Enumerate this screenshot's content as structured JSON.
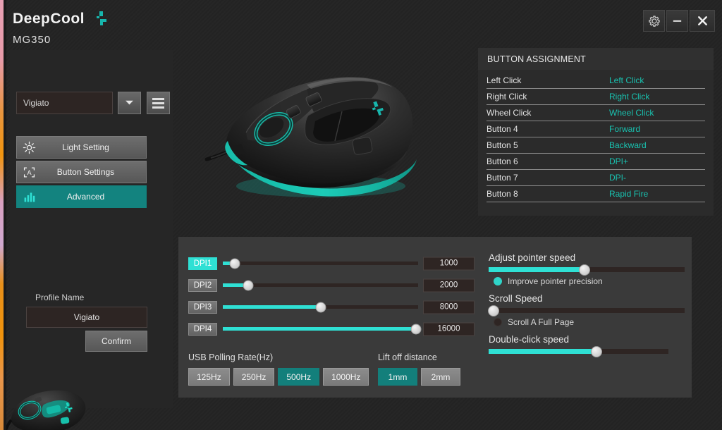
{
  "header": {
    "brand": "DeepCool",
    "brand_logo_icon": "deepcool-logo-icon",
    "model": "MG350",
    "window_controls": [
      {
        "name": "settings-button",
        "icon": "gear-icon"
      },
      {
        "name": "minimize-button",
        "icon": "minimize-icon"
      },
      {
        "name": "close-button",
        "icon": "close-icon"
      }
    ]
  },
  "sidebar": {
    "profile_selected": "Vigiato",
    "profile_dropdown_icon": "chevron-down-icon",
    "menu_icon": "hamburger-icon",
    "nav_items": [
      {
        "label": "Light Setting",
        "icon": "brightness-icon",
        "active": false
      },
      {
        "label": "Button Settings",
        "icon": "assign-key-icon",
        "active": false
      },
      {
        "label": "Advanced",
        "icon": "bar-chart-icon",
        "active": true
      }
    ],
    "profile_name_label": "Profile Name",
    "profile_name_value": "Vigiato",
    "confirm_label": "Confirm"
  },
  "hero": {
    "product_icon": "gaming-mouse-render",
    "corner_icon": "gaming-mouse-thumbnail"
  },
  "button_assignment": {
    "title": "BUTTON ASSIGNMENT",
    "rows": [
      {
        "key": "Left Click",
        "value": "Left Click"
      },
      {
        "key": "Right Click",
        "value": "Right Click"
      },
      {
        "key": "Wheel Click",
        "value": "Wheel Click"
      },
      {
        "key": "Button 4",
        "value": "Forward"
      },
      {
        "key": "Button 5",
        "value": "Backward"
      },
      {
        "key": "Button 6",
        "value": "DPI+"
      },
      {
        "key": "Button 7",
        "value": "DPI-"
      },
      {
        "key": "Button 8",
        "value": "Rapid Fire"
      }
    ]
  },
  "dpi": {
    "levels": [
      {
        "tag": "DPI1",
        "value": "1000",
        "percent": 6,
        "selected": true
      },
      {
        "tag": "DPI2",
        "value": "2000",
        "percent": 13,
        "selected": false
      },
      {
        "tag": "DPI3",
        "value": "8000",
        "percent": 50,
        "selected": false
      },
      {
        "tag": "DPI4",
        "value": "16000",
        "percent": 99,
        "selected": false
      }
    ]
  },
  "polling_rate": {
    "title": "USB Polling Rate(Hz)",
    "options": [
      {
        "label": "125Hz",
        "selected": false
      },
      {
        "label": "250Hz",
        "selected": false
      },
      {
        "label": "500Hz",
        "selected": true
      },
      {
        "label": "1000Hz",
        "selected": false
      }
    ]
  },
  "lift_off": {
    "title": "Lift off distance",
    "options": [
      {
        "label": "1mm",
        "selected": true
      },
      {
        "label": "2mm",
        "selected": false
      }
    ]
  },
  "pointer": {
    "adjust_speed_label": "Adjust pointer speed",
    "adjust_speed_percent": 49,
    "improve_precision_label": "Improve pointer precision",
    "improve_precision_checked": true,
    "scroll_speed_label": "Scroll Speed",
    "scroll_speed_percent": 2,
    "scroll_full_page_label": "Scroll A Full Page",
    "scroll_full_page_checked": false,
    "double_click_label": "Double-click speed",
    "double_click_percent": 60
  },
  "colors": {
    "accent_cyan": "#2fe0d4",
    "accent_teal": "#13837f",
    "value_text": "#19c2b0",
    "panel_bg": "#3a3a3a",
    "app_bg": "#232323"
  }
}
